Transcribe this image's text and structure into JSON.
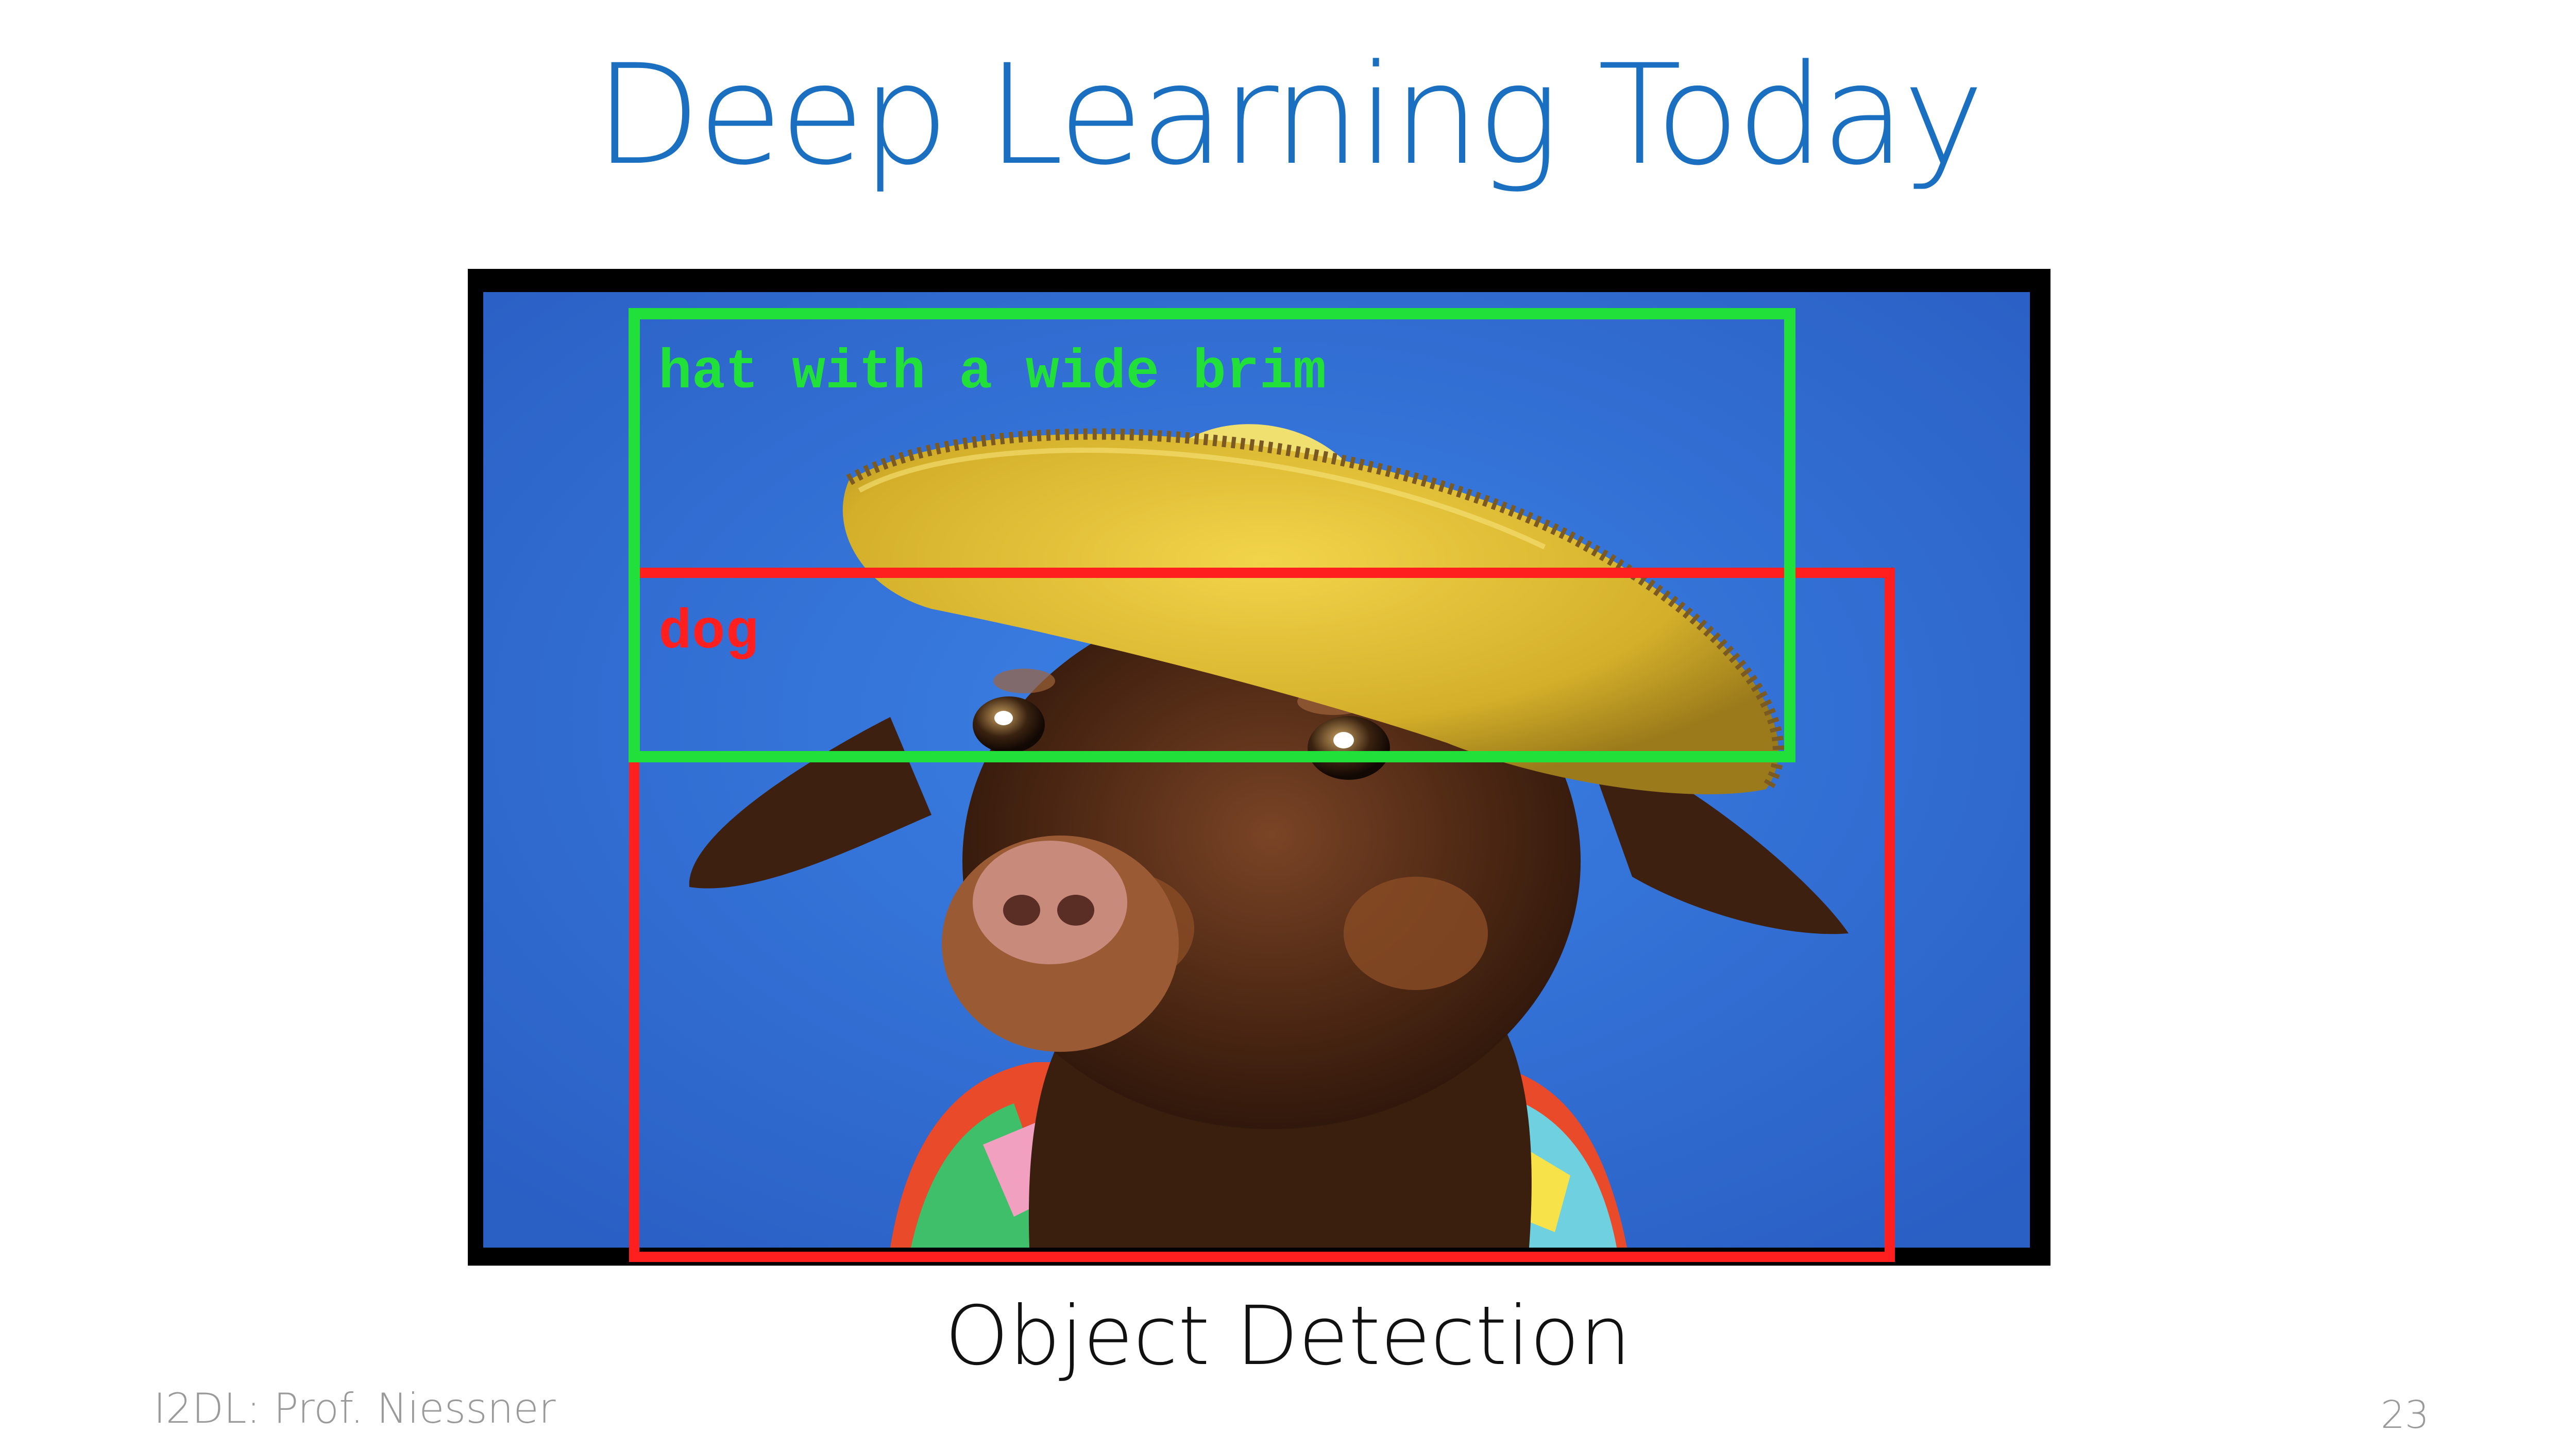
{
  "slide": {
    "title": "Deep Learning Today",
    "caption": "Object Detection",
    "footer_left": "I2DL: Prof. Niessner",
    "page_number": "23"
  },
  "detections": [
    {
      "label": "hat with a wide brim",
      "color": "#22e03a"
    },
    {
      "label": "dog",
      "color": "#ff1f1f"
    }
  ],
  "colors": {
    "title": "#1a6fc0",
    "photo_background": "#2f6fd6",
    "frame": "#000000"
  }
}
